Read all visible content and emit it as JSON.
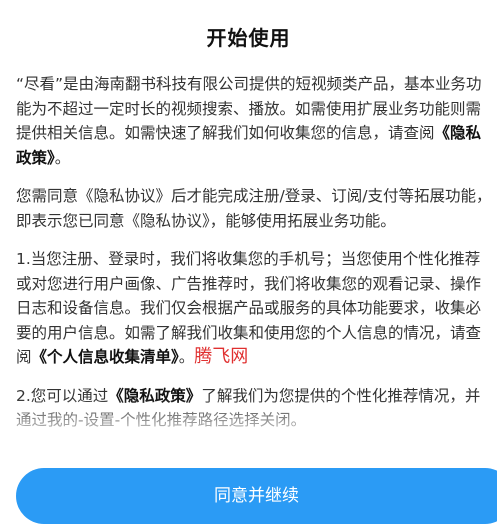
{
  "dialog": {
    "title": "开始使用",
    "p1": {
      "text": "“尽看”是由海南翻书科技有限公司提供的短视频类产品，基本业务功能为不超过一定时长的视频搜索、播放。如需使用扩展业务功能则需提供相关信息。如需快速了解我们如何收集您的信息，请查阅",
      "link": "《隐私政策》",
      "tail": "。"
    },
    "p2": {
      "text": "您需同意《隐私协议》后才能完成注册/登录、订阅/支付等拓展功能，即表示您已同意《隐私协议》，能够使用拓展业务功能。"
    },
    "p3": {
      "text": "1.当您注册、登录时，我们将收集您的手机号；当您使用个性化推荐或对您进行用户画像、广告推荐时，我们将收集您的观看记录、操作日志和设备信息。我们仅会根据产品或服务的具体功能要求，收集必要的用户信息。如需了解我们收集和使用您的个人信息的情况，请查阅",
      "link": "《个人信息收集清单》",
      "tail": "。",
      "watermark": "腾飞网"
    },
    "p4": {
      "prefix": "2.您可以通过",
      "link": "《隐私政策》",
      "text": "了解我们为您提供的个性化推荐情况，并通过我的-设置-个性化推荐路径选择关闭。"
    },
    "agree_button": "同意并继续"
  }
}
